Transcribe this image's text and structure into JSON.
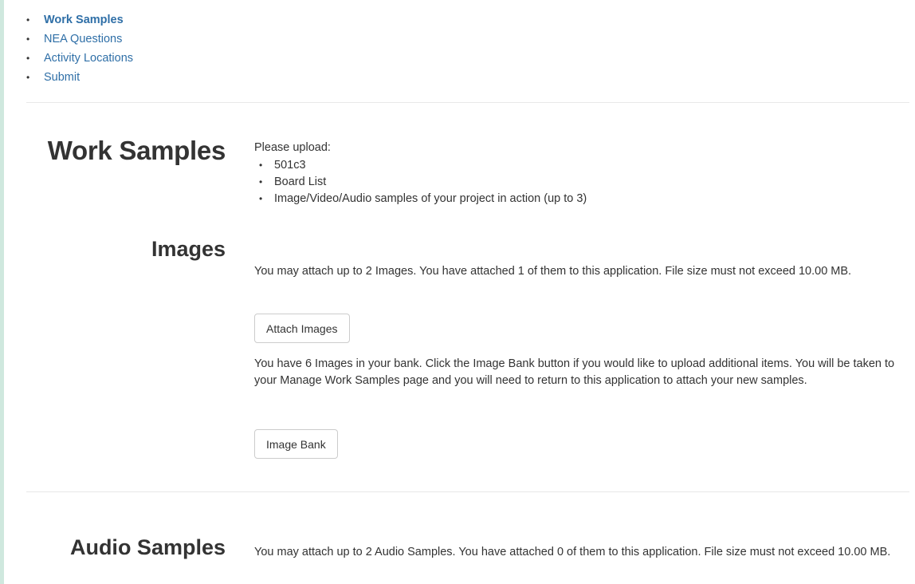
{
  "nav": {
    "items": [
      {
        "label": "Work Samples",
        "active": true
      },
      {
        "label": "NEA Questions",
        "active": false
      },
      {
        "label": "Activity Locations",
        "active": false
      },
      {
        "label": "Submit",
        "active": false
      }
    ]
  },
  "work_samples": {
    "heading": "Work Samples",
    "upload_label": "Please upload:",
    "upload_items": [
      "501c3",
      "Board List",
      "Image/Video/Audio samples of your project in action (up to 3)"
    ]
  },
  "images": {
    "heading": "Images",
    "attach_info": "You may attach up to 2 Images. You have attached 1 of them to this application. File size must not exceed 10.00 MB.",
    "attach_button": "Attach Images",
    "bank_info": "You have 6 Images in your bank. Click the Image Bank button if you would like to upload additional items. You will be taken to your Manage Work Samples page and you will need to return to this application to attach your new samples.",
    "bank_button": "Image Bank"
  },
  "audio": {
    "heading": "Audio Samples",
    "attach_info": "You may attach up to 2 Audio Samples. You have attached 0 of them to this application. File size must not exceed 10.00 MB."
  },
  "colors": {
    "link": "#2f6fa7",
    "accent_bar": "#cfe8de",
    "text": "#333333"
  }
}
